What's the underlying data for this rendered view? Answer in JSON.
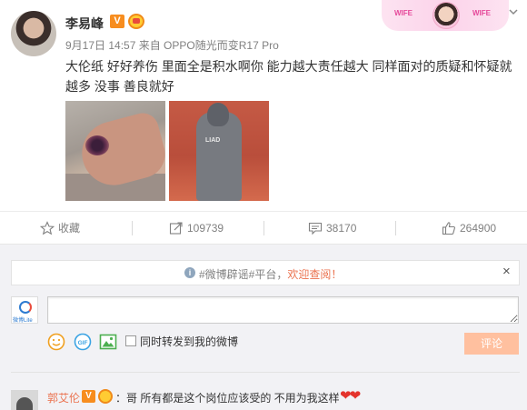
{
  "post": {
    "username": "李易峰",
    "verified_badge": "V",
    "meta": "9月17日 14:57 来自 OPPO随光而变R17 Pro",
    "content": "大伦纸 好好养伤 里面全是积水啊你 能力越大责任越大  同样面对的质疑和怀疑就越多 没事  善良就好",
    "card_tags": [
      "WIFE",
      "WIFE"
    ],
    "image_2_label": "LIAD"
  },
  "actions": {
    "favorite": "收藏",
    "repost": "109739",
    "comments": "38170",
    "likes": "264900"
  },
  "notice": {
    "prefix": "#微博辟谣#平台，",
    "link": "欢迎查阅！"
  },
  "composer": {
    "input_value": "",
    "repost_checkbox_label": "同时转发到我的微博",
    "submit_label": "评论",
    "avatar_text": "微博Lite"
  },
  "comment": {
    "author": "郭艾伦",
    "verified_badge": "V",
    "text": "：哥 所有都是这个岗位应该受的 不用为我这样"
  },
  "colors": {
    "accent": "#eb7350",
    "badge": "#f78d1f",
    "submit_disabled": "#ffc09f",
    "heart": "#e4332c"
  }
}
